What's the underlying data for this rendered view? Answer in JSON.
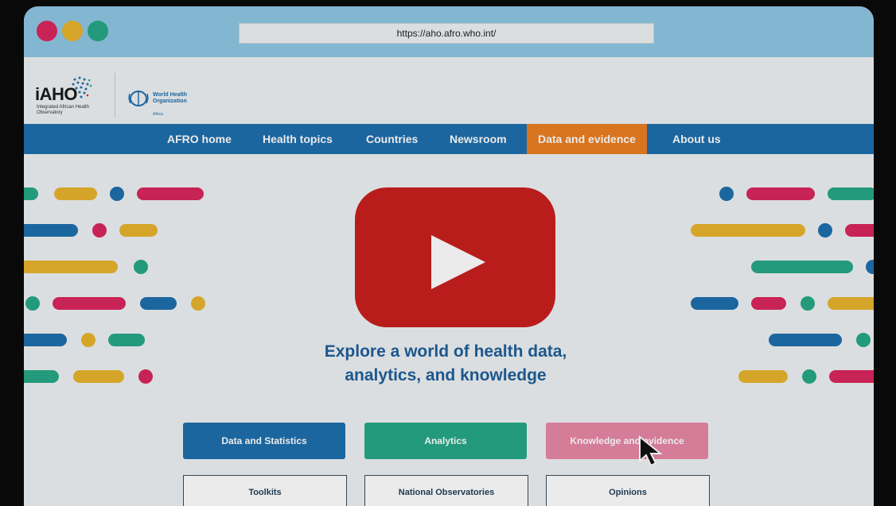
{
  "browser": {
    "url": "https://aho.afro.who.int/"
  },
  "brand": {
    "logo_text": "iAHO",
    "logo_subtext": "Integrated African Health Observatory",
    "who_name": "World Health Organization",
    "who_region": "Africa"
  },
  "nav": {
    "items": [
      "AFRO home",
      "Health topics",
      "Countries",
      "Newsroom",
      "Data and evidence",
      "About us"
    ],
    "active": "Data and evidence"
  },
  "hero": {
    "headline_line1": "Explore a world of health data,",
    "headline_line2": "analytics, and knowledge"
  },
  "tiles": {
    "primary": [
      {
        "label": "Data and Statistics",
        "color": "#1f6fad"
      },
      {
        "label": "Analytics",
        "color": "#27a886"
      },
      {
        "label": "Knowledge and evidence",
        "color": "#e887a6"
      }
    ],
    "secondary": [
      "Toolkits",
      "National Observatories",
      "Opinions"
    ]
  },
  "colors": {
    "accent_orange": "#ec7e22",
    "nav_blue": "#1f6fad",
    "play_red": "#c8201f"
  },
  "icons": {
    "play": "play-icon",
    "cursor": "mouse-pointer-icon"
  }
}
